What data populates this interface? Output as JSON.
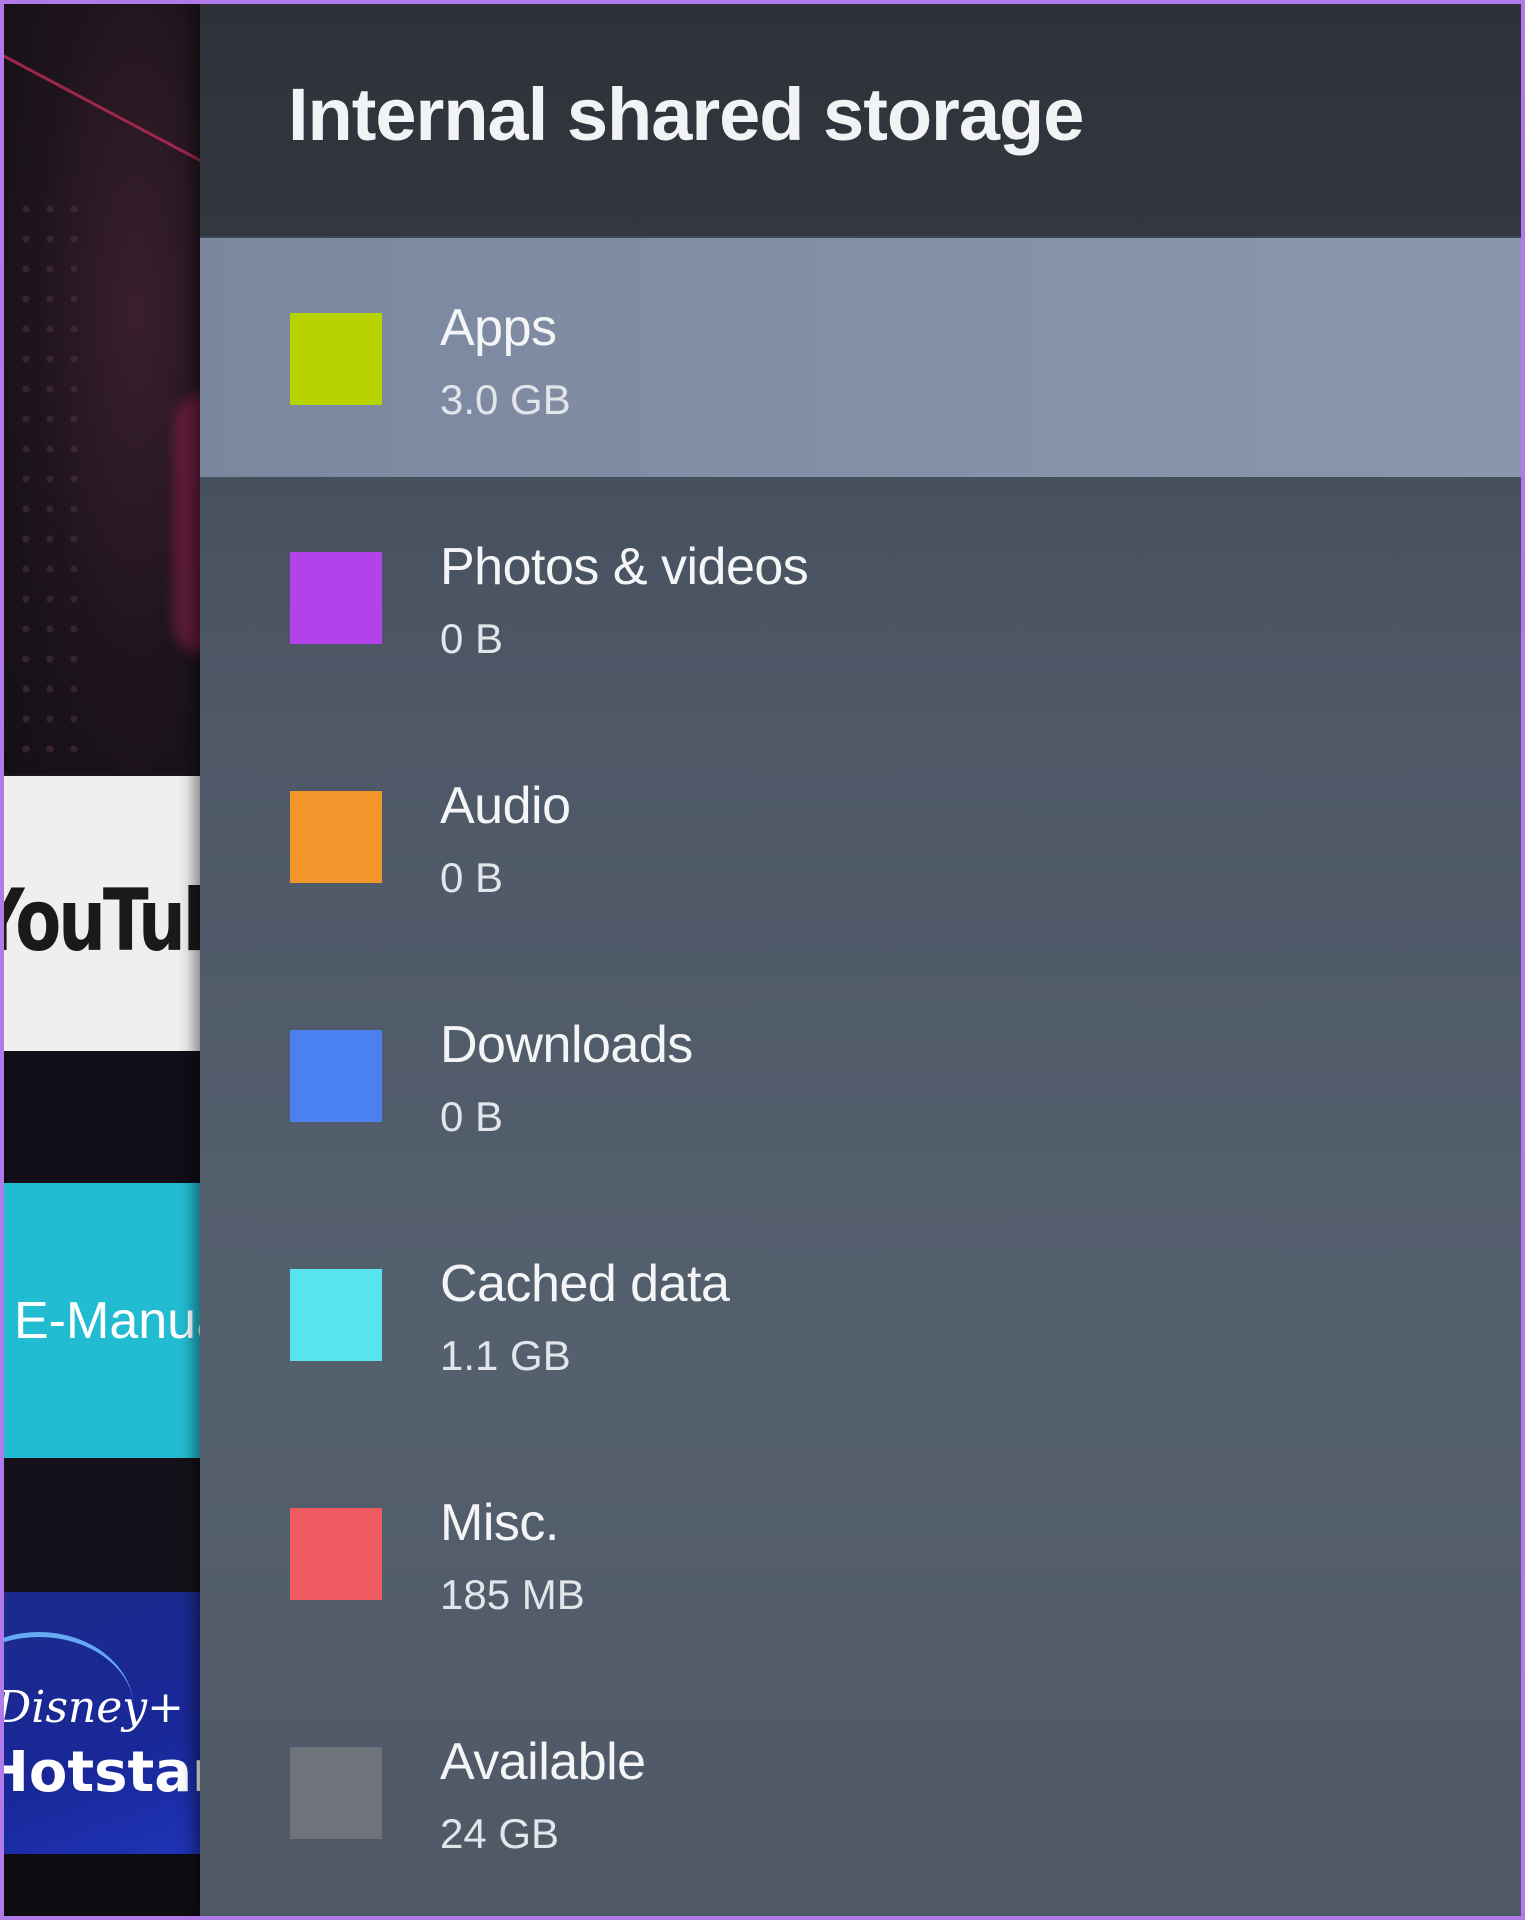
{
  "background": {
    "tiles": [
      {
        "id": "youtube",
        "label": "YouTube"
      },
      {
        "id": "emanual",
        "label": "E-Manual"
      },
      {
        "id": "hotstar",
        "brand_top": "Disney+",
        "brand_bottom": "Hotstar"
      }
    ]
  },
  "panel": {
    "title": "Internal shared storage",
    "items": [
      {
        "label": "Apps",
        "value": "3.0 GB",
        "color": "#b7d400",
        "focused": true
      },
      {
        "label": "Photos & videos",
        "value": "0 B",
        "color": "#b242ea",
        "focused": false
      },
      {
        "label": "Audio",
        "value": "0 B",
        "color": "#f2962c",
        "focused": false
      },
      {
        "label": "Downloads",
        "value": "0 B",
        "color": "#4a80f0",
        "focused": false
      },
      {
        "label": "Cached data",
        "value": "1.1 GB",
        "color": "#56e4f0",
        "focused": false
      },
      {
        "label": "Misc.",
        "value": "185 MB",
        "color": "#ef5a63",
        "focused": false
      },
      {
        "label": "Available",
        "value": "24 GB",
        "color": "#6e737c",
        "focused": false
      }
    ]
  }
}
